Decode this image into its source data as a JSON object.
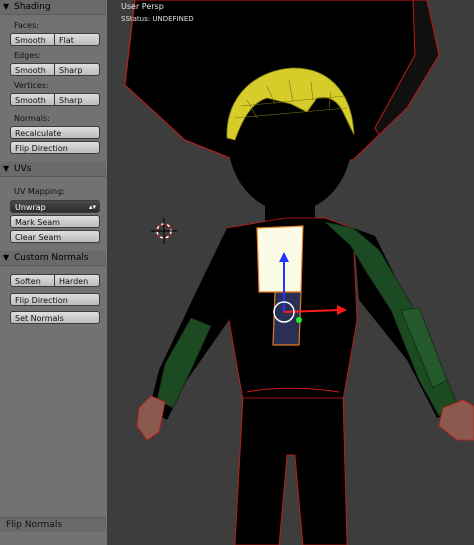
{
  "viewport": {
    "title": "User Persp",
    "status": "SStatus: UNDEFINED"
  },
  "shading": {
    "header": "Shading",
    "faces_label": "Faces:",
    "faces_smooth": "Smooth",
    "faces_flat": "Flat",
    "edges_label": "Edges:",
    "edges_smooth": "Smooth",
    "edges_sharp": "Sharp",
    "vertices_label": "Vertices:",
    "vertices_smooth": "Smooth",
    "vertices_sharp": "Sharp",
    "normals_label": "Normals:",
    "recalculate": "Recalculate",
    "flip_direction": "Flip Direction"
  },
  "uvs": {
    "header": "UVs",
    "mapping_label": "UV Mapping:",
    "unwrap": "Unwrap",
    "mark_seam": "Mark Seam",
    "clear_seam": "Clear Seam"
  },
  "custom_normals": {
    "header": "Custom Normals",
    "soften": "Soften",
    "harden": "Harden",
    "flip_direction": "Flip Direction",
    "set_normals": "Set Normals"
  },
  "operator": {
    "header": "Flip Normals"
  },
  "icons": {
    "collapse": "triangle-down-icon",
    "dropdown": "up-down-arrows-icon",
    "cursor": "3d-cursor-icon",
    "gizmo": "transform-gizmo-icon"
  },
  "colors": {
    "shelf": "#727272",
    "viewport": "#3d3d3d",
    "mesh_black": "#000000",
    "hair_yellow": "#d6cc2a",
    "sleeve_green": "#1c4a22",
    "selection_orange": "#e07a20",
    "edge_red": "#e01818"
  }
}
